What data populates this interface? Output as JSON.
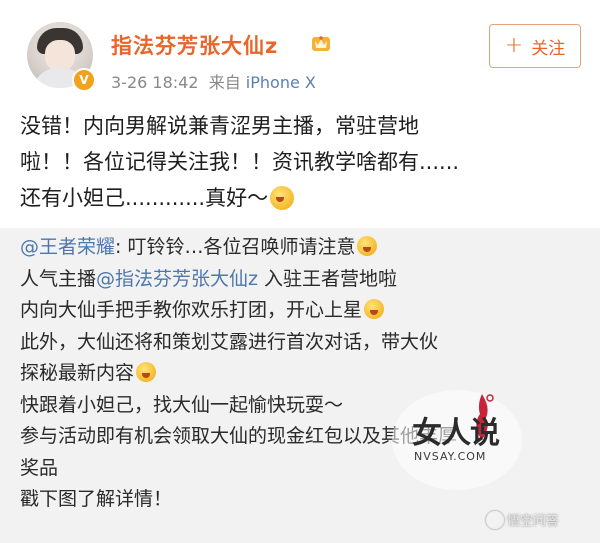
{
  "post": {
    "username": "指法芬芳张大仙z",
    "meta_time": "3-26 18:42",
    "meta_from": "来自",
    "meta_source": "iPhone X",
    "follow_label": "关注",
    "text_lines": [
      "没错！内向男解说兼青涩男主播，常驻营地",
      "啦！！各位记得关注我！！资讯教学啥都有......",
      "还有小妲己............真好～"
    ]
  },
  "repost": {
    "line1_mention": "@王者荣耀",
    "line1_text": ": 叮铃铃…各位召唤师请注意",
    "line2_prefix": "人气主播",
    "line2_mention": "@指法芬芳张大仙z",
    "line2_suffix": " 入驻王者营地啦",
    "line3": "内向大仙手把手教你欢乐打团，开心上星",
    "line4": "此外，大仙还将和策划艾露进行首次对话，带大伙",
    "line5": "探秘最新内容",
    "line6": "快跟着小妲己，找大仙一起愉快玩耍～",
    "line7": "参与活动即有机会领取大仙的现金红包以及其他丰厚",
    "line8": "奖品",
    "line9": "戳下图了解详情！"
  },
  "watermark": {
    "logo": "女人说",
    "site": "NVSAY.COM",
    "corner": "悟空问答"
  },
  "colors": {
    "username": "#e8662a",
    "mention": "#4d77ad",
    "repost_bg": "#f2f2f2"
  }
}
